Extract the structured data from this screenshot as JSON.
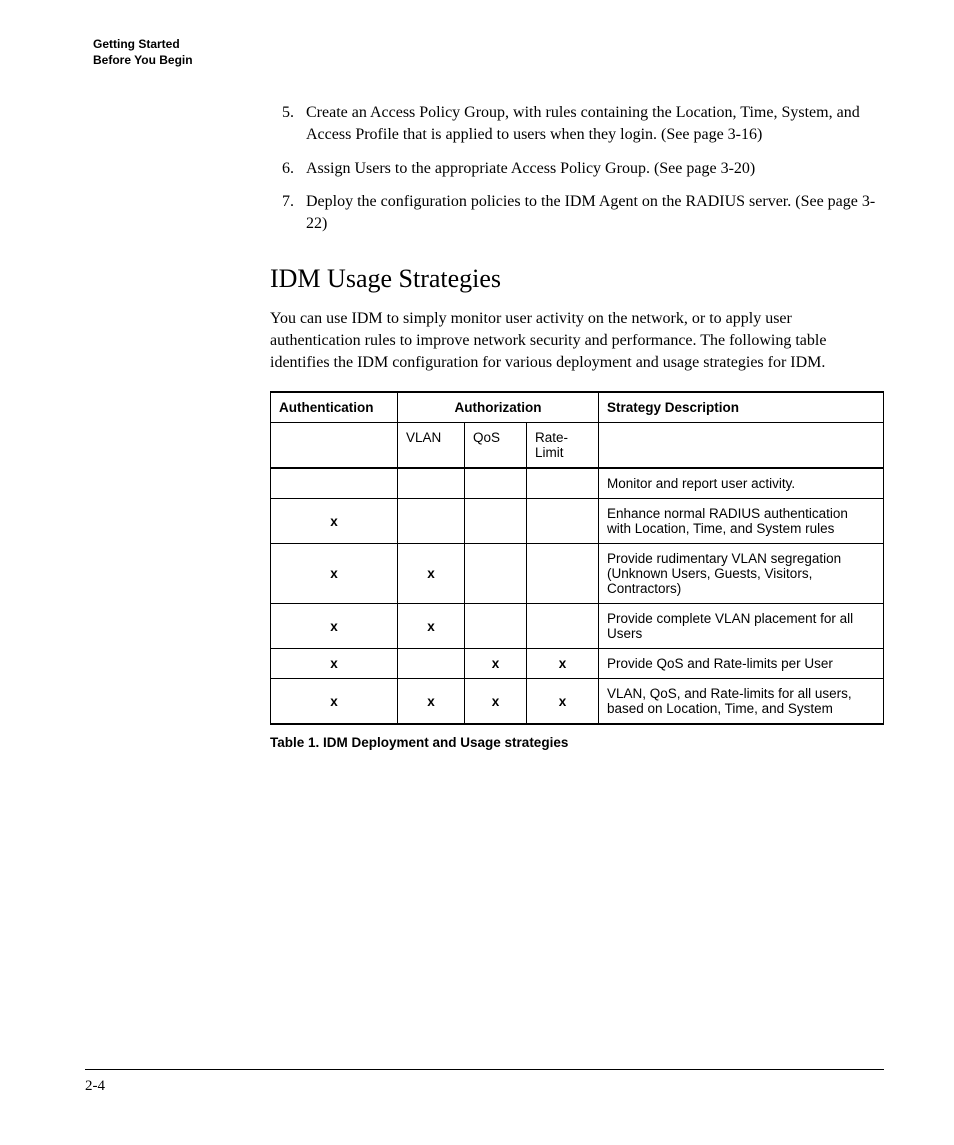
{
  "header": {
    "line1": "Getting Started",
    "line2": "Before You Begin"
  },
  "steps": {
    "start": 5,
    "items": [
      "Create an Access Policy Group, with rules containing the Location, Time, System, and Access Profile that is applied to users when they login. (See page 3-16)",
      "Assign Users to the appropriate Access Policy Group. (See page 3-20)",
      "Deploy the configuration policies to the IDM Agent on the RADIUS server. (See page 3-22)"
    ]
  },
  "section": {
    "heading": "IDM Usage Strategies",
    "intro": "You can use IDM to simply monitor user activity on the network, or to apply user authentication rules to improve network security and performance. The following table identifies the IDM configuration for various deployment and usage strategies for IDM."
  },
  "table": {
    "headers": {
      "auth": "Authentication",
      "authorization": "Authorization",
      "desc": "Strategy Description"
    },
    "subheaders": {
      "vlan": "VLAN",
      "qos": "QoS",
      "rate": "Rate-Limit"
    },
    "mark": "x",
    "rows": [
      {
        "auth": false,
        "vlan": false,
        "qos": false,
        "rate": false,
        "desc": "Monitor and report user activity."
      },
      {
        "auth": true,
        "vlan": false,
        "qos": false,
        "rate": false,
        "desc": "Enhance normal RADIUS authentication with Location, Time, and System rules"
      },
      {
        "auth": true,
        "vlan": true,
        "qos": false,
        "rate": false,
        "desc": "Provide rudimentary VLAN segregation (Unknown Users, Guests, Visitors, Contractors)"
      },
      {
        "auth": true,
        "vlan": true,
        "qos": false,
        "rate": false,
        "desc": "Provide complete VLAN placement for all Users"
      },
      {
        "auth": true,
        "vlan": false,
        "qos": true,
        "rate": true,
        "desc": "Provide QoS and Rate-limits per User"
      },
      {
        "auth": true,
        "vlan": true,
        "qos": true,
        "rate": true,
        "desc": "VLAN, QoS, and Rate-limits for all users, based on Location, Time, and System"
      }
    ],
    "caption": "Table 1.   IDM Deployment and Usage strategies"
  },
  "footer": {
    "page": "2-4"
  }
}
